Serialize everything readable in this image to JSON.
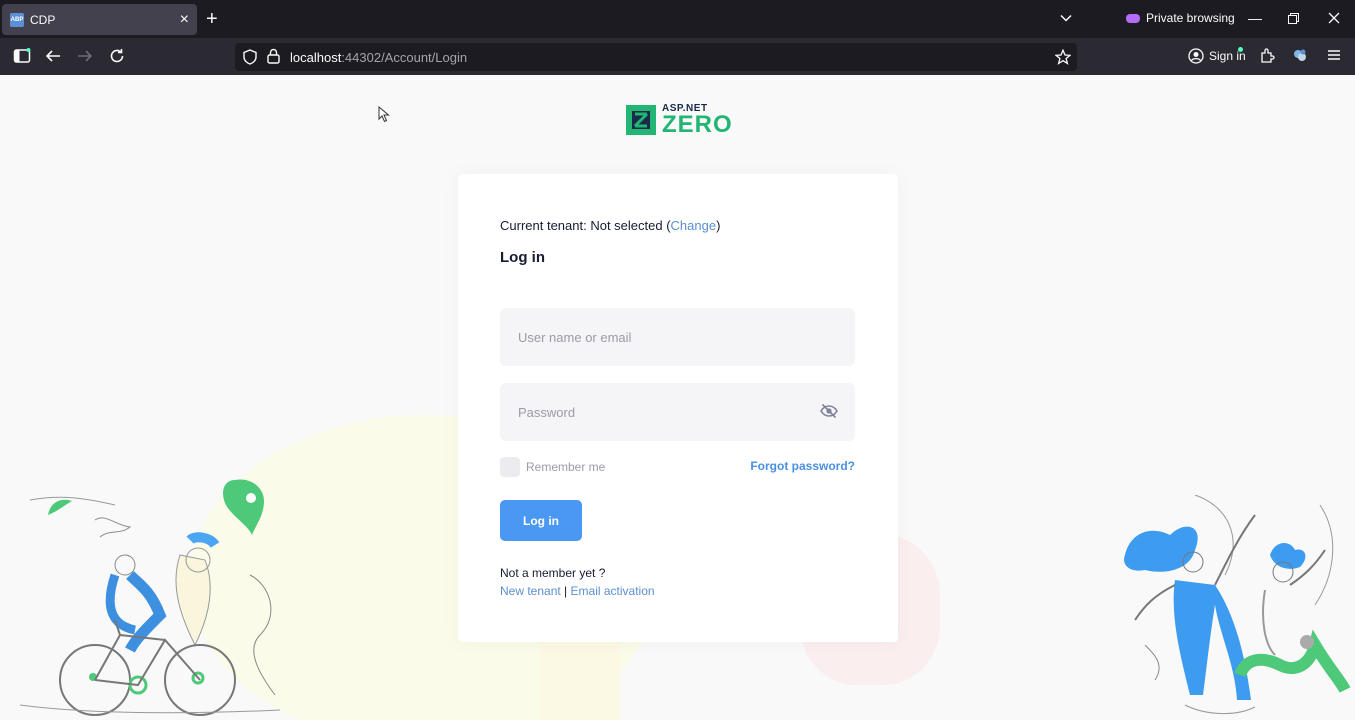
{
  "browser": {
    "tab": {
      "title": "CDP",
      "favicon_text": "ABP"
    },
    "private_label": "Private browsing",
    "url": {
      "host": "localhost",
      "rest": ":44302/Account/Login"
    },
    "signin_label": "Sign in",
    "icons": [
      "sidebar-icon",
      "back-icon",
      "forward-icon",
      "reload-icon",
      "shield-icon",
      "lock-icon",
      "star-icon",
      "account-icon",
      "extensions-icon",
      "addon-icon",
      "menu-icon"
    ]
  },
  "logo": {
    "top": "ASP.NET",
    "main": "ZERO"
  },
  "login": {
    "tenant_prefix": "Current tenant: Not selected (",
    "tenant_link": "Change",
    "tenant_suffix": ")",
    "title": "Log in",
    "username_placeholder": "User name or email",
    "password_placeholder": "Password",
    "remember_label": "Remember me",
    "forgot_label": "Forgot password?",
    "submit_label": "Log in",
    "not_member": "Not a member yet ?",
    "new_tenant": "New tenant",
    "separator": "|",
    "email_activation": "Email activation"
  },
  "colors": {
    "accent": "#4a98f2",
    "brand_green": "#22b573",
    "link": "#5a8fd0"
  }
}
